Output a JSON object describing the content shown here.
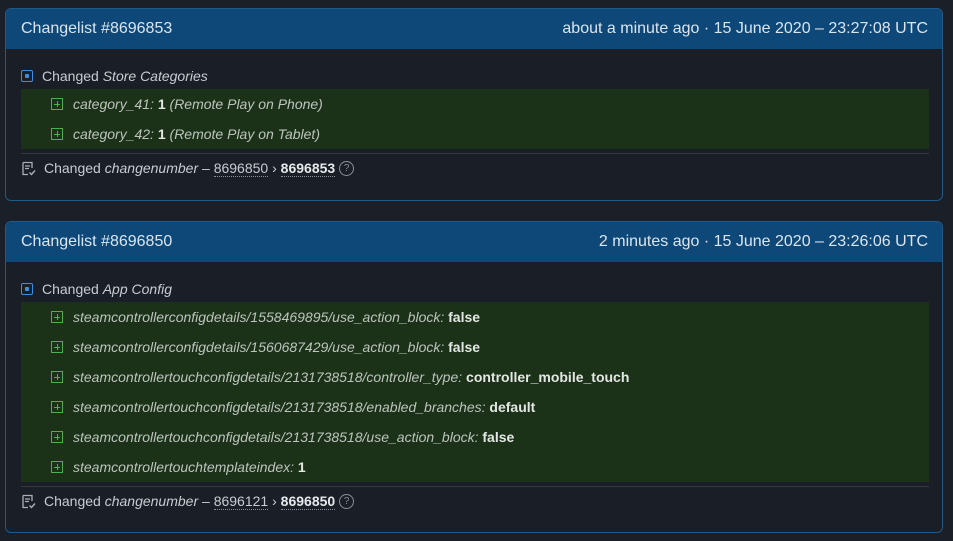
{
  "changelists": [
    {
      "title": "Changelist #8696853",
      "time": "about a minute ago · 15 June 2020 – 23:27:08 UTC",
      "section": {
        "prefix": "Changed",
        "name": "Store Categories"
      },
      "rows": [
        {
          "key": "category_41:",
          "value": "1",
          "note": "(Remote Play on Phone)"
        },
        {
          "key": "category_42:",
          "value": "1",
          "note": "(Remote Play on Tablet)"
        }
      ],
      "change": {
        "prefix": "Changed",
        "field": "changenumber",
        "dash": "–",
        "old": "8696850",
        "arrow": "›",
        "new": "8696853",
        "help": "?"
      }
    },
    {
      "title": "Changelist #8696850",
      "time": "2 minutes ago · 15 June 2020 – 23:26:06 UTC",
      "section": {
        "prefix": "Changed",
        "name": "App Config"
      },
      "rows": [
        {
          "key": "steamcontrollerconfigdetails/1558469895/use_action_block:",
          "value": "false",
          "note": ""
        },
        {
          "key": "steamcontrollerconfigdetails/1560687429/use_action_block:",
          "value": "false",
          "note": ""
        },
        {
          "key": "steamcontrollertouchconfigdetails/2131738518/controller_type:",
          "value": "controller_mobile_touch",
          "note": ""
        },
        {
          "key": "steamcontrollertouchconfigdetails/2131738518/enabled_branches:",
          "value": "default",
          "note": ""
        },
        {
          "key": "steamcontrollertouchconfigdetails/2131738518/use_action_block:",
          "value": "false",
          "note": ""
        },
        {
          "key": "steamcontrollertouchtemplateindex:",
          "value": "1",
          "note": ""
        }
      ],
      "change": {
        "prefix": "Changed",
        "field": "changenumber",
        "dash": "–",
        "old": "8696121",
        "arrow": "›",
        "new": "8696850",
        "help": "?"
      }
    }
  ]
}
